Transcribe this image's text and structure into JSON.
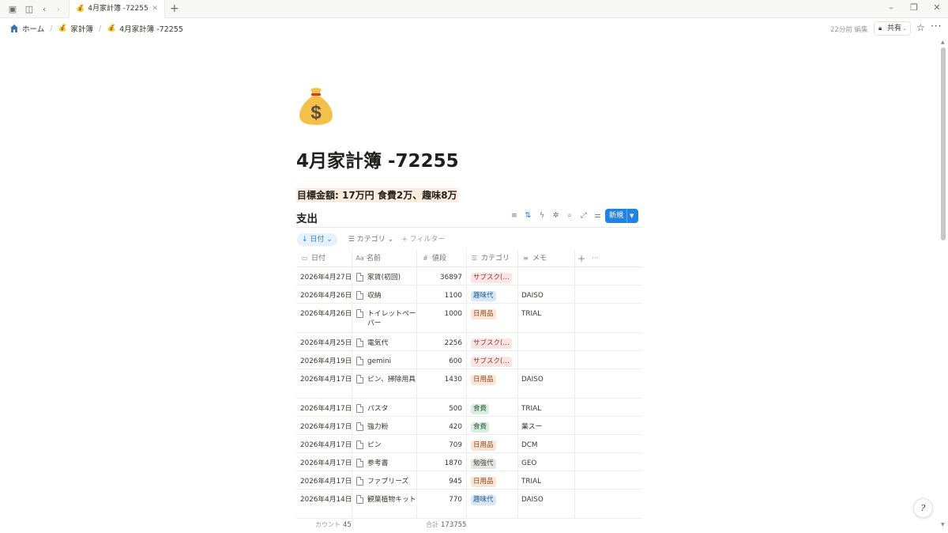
{
  "window": {
    "tab_emoji": "💰",
    "tab_title": "4月家計簿 -72255",
    "new_tab": "+"
  },
  "breadcrumb": {
    "home": "ホーム",
    "parent": "家計簿",
    "current": "4月家計簿 -72255",
    "separator": "/",
    "parent_emoji": "💰",
    "current_emoji": "💰"
  },
  "topbar": {
    "edited": "22分前 編集",
    "share": "共有"
  },
  "page": {
    "title": "4月家計簿 -72255",
    "goal": "目標金額: 17万円 食費2万、趣味8万"
  },
  "database": {
    "title": "支出",
    "new_button": "新規",
    "sort_chip": "↓ 日付",
    "group_chip": "カテゴリ",
    "add_filter": "+ フィルター",
    "columns": {
      "date": "日付",
      "name": "名前",
      "amount": "値段",
      "category": "カテゴリ",
      "memo": "メモ"
    },
    "rows": [
      {
        "date": "2026年4月27日",
        "name": "家賃(初回)",
        "amount": "36897",
        "category": "サブスク(…",
        "memo": ""
      },
      {
        "date": "2026年4月26日",
        "name": "収納",
        "amount": "1100",
        "category": "趣味代",
        "memo": "DAISO"
      },
      {
        "date": "2026年4月26日",
        "name": "トイレットペーパー",
        "amount": "1000",
        "category": "日用品",
        "memo": "TRIAL"
      },
      {
        "date": "2026年4月25日",
        "name": "電気代",
        "amount": "2256",
        "category": "サブスク(…",
        "memo": ""
      },
      {
        "date": "2026年4月19日",
        "name": "gemini",
        "amount": "600",
        "category": "サブスク(…",
        "memo": ""
      },
      {
        "date": "2026年4月17日",
        "name": "ピン、掃除用具",
        "amount": "1430",
        "category": "日用品",
        "memo": "DAISO"
      },
      {
        "date": "2026年4月17日",
        "name": "パスタ",
        "amount": "500",
        "category": "食費",
        "memo": "TRIAL"
      },
      {
        "date": "2026年4月17日",
        "name": "強力粉",
        "amount": "420",
        "category": "食費",
        "memo": "業スー"
      },
      {
        "date": "2026年4月17日",
        "name": "ピン",
        "amount": "709",
        "category": "日用品",
        "memo": "DCM"
      },
      {
        "date": "2026年4月17日",
        "name": "参考書",
        "amount": "1870",
        "category": "勉強代",
        "memo": "GEO"
      },
      {
        "date": "2026年4月17日",
        "name": "ファブリーズ",
        "amount": "945",
        "category": "日用品",
        "memo": "TRIAL"
      },
      {
        "date": "2026年4月14日",
        "name": "観葉植物キット",
        "amount": "770",
        "category": "趣味代",
        "memo": "DAISO"
      }
    ],
    "footer": {
      "count_label": "カウント",
      "count": "45",
      "sum_label": "合計",
      "sum": "173755"
    }
  },
  "tag_colors": {
    "サブスク(…": {
      "bg": "#fbe4e4",
      "fg": "#8a3a32"
    },
    "趣味代": {
      "bg": "#d8e8f7",
      "fg": "#1f5a8c"
    },
    "日用品": {
      "bg": "#fbe4d6",
      "fg": "#8a4b22"
    },
    "食費": {
      "bg": "#dbede1",
      "fg": "#2b5e3d"
    },
    "勉強代": {
      "bg": "#e6e5e1",
      "fg": "#4a4945"
    }
  },
  "help": "?"
}
